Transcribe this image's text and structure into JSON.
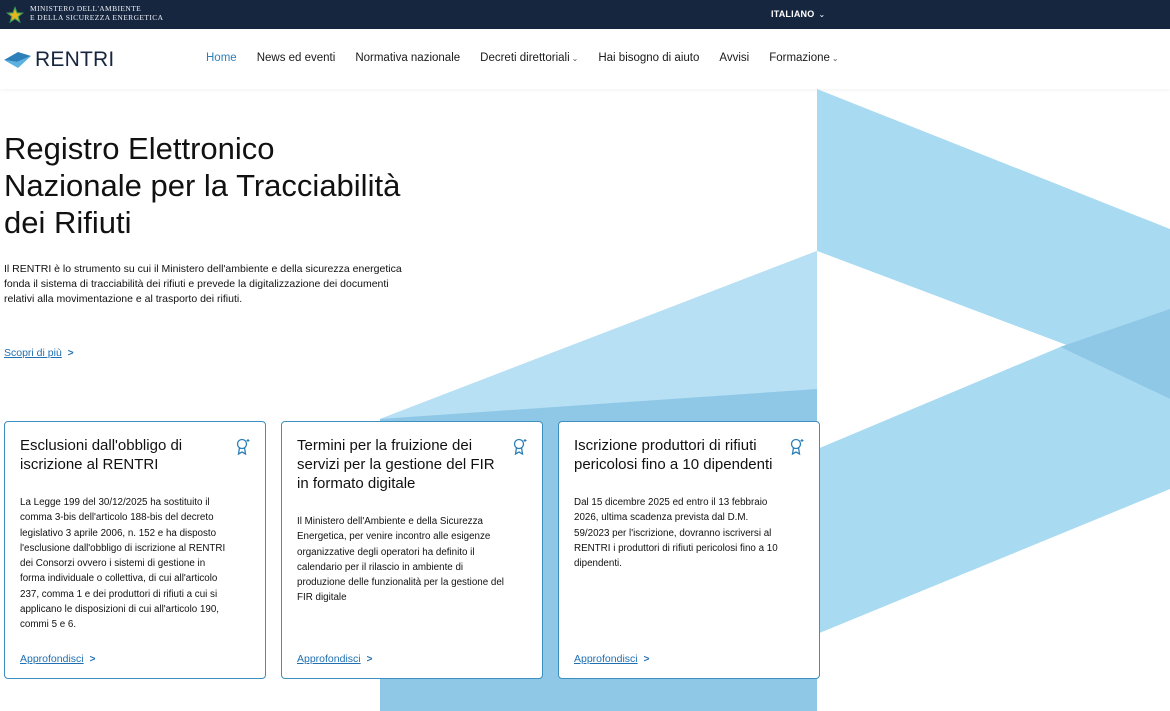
{
  "ministry": {
    "line1": "MINISTERO DELL'AMBIENTE",
    "line2": "E DELLA SICUREZZA ENERGETICA"
  },
  "language": "ITALIANO",
  "brand": {
    "name": "RENTRI"
  },
  "nav": {
    "items": [
      {
        "label": "Home",
        "active": true,
        "dropdown": false
      },
      {
        "label": "News ed eventi",
        "active": false,
        "dropdown": false
      },
      {
        "label": "Normativa nazionale",
        "active": false,
        "dropdown": false
      },
      {
        "label": "Decreti direttoriali",
        "active": false,
        "dropdown": true
      },
      {
        "label": "Hai bisogno di aiuto",
        "active": false,
        "dropdown": false
      },
      {
        "label": "Avvisi",
        "active": false,
        "dropdown": false
      },
      {
        "label": "Formazione",
        "active": false,
        "dropdown": true
      }
    ]
  },
  "hero": {
    "title_line1": "Registro Elettronico",
    "title_line2": "Nazionale per la Tracciabilità",
    "title_line3": "dei Rifiuti",
    "desc_line1": "Il RENTRI è lo strumento su cui il Ministero dell'ambiente e della sicurezza energetica",
    "desc_line2": "fonda il sistema di tracciabilità dei rifiuti e prevede la digitalizzazione dei documenti",
    "desc_line3": "relativi alla movimentazione e al trasporto dei rifiuti.",
    "link": "Scopri di più"
  },
  "cards": [
    {
      "title_lines": [
        "Esclusioni dall'obbligo di",
        "iscrizione al RENTRI"
      ],
      "body_lines": [
        "La Legge 199 del 30/12/2025 ha sostituito il",
        "comma 3-bis dell'articolo 188-bis del decreto",
        "legislativo 3 aprile 2006, n. 152 e ha disposto",
        "l'esclusione dall'obbligo di iscrizione al RENTRI",
        "dei Consorzi ovvero i sistemi di gestione in",
        "forma individuale o collettiva, di cui all'articolo",
        "237, comma 1 e dei produttori di rifiuti a cui si",
        "applicano le disposizioni di cui all'articolo 190,",
        "commi 5 e 6."
      ],
      "link": "Approfondisci"
    },
    {
      "title_lines": [
        "Termini per la fruizione dei",
        "servizi per la gestione del FIR",
        "in formato digitale"
      ],
      "body_lines": [
        "Il Ministero dell'Ambiente e della Sicurezza",
        "Energetica, per venire incontro alle esigenze",
        "organizzative degli operatori ha definito il",
        "calendario per il rilascio in ambiente di",
        "produzione delle funzionalità per la gestione del",
        "FIR digitale"
      ],
      "link": "Approfondisci"
    },
    {
      "title_lines": [
        "Iscrizione produttori di rifiuti",
        "pericolosi fino a 10 dipendenti"
      ],
      "body_lines": [
        "Dal 15 dicembre 2025 ed entro il 13 febbraio",
        "2026, ultima scadenza prevista dal D.M.",
        "59/2023 per l'iscrizione, dovranno iscriversi al",
        "RENTRI i produttori di rifiuti pericolosi fino a 10",
        "dipendenti."
      ],
      "link": "Approfondisci"
    }
  ],
  "icons": {
    "ministry": "star-emblem-icon",
    "language": "chevron-down-icon",
    "brand": "rentri-logo-icon",
    "card": "award-badge-icon",
    "link": "chevron-right-icon"
  },
  "colors": {
    "topbar": "#17263f",
    "accent": "#2c7fb8",
    "link": "#1f6fb2",
    "card_border": "#3d8fc0",
    "shape_light": "#a8daf2",
    "shape_mid": "#8fc8e6"
  }
}
